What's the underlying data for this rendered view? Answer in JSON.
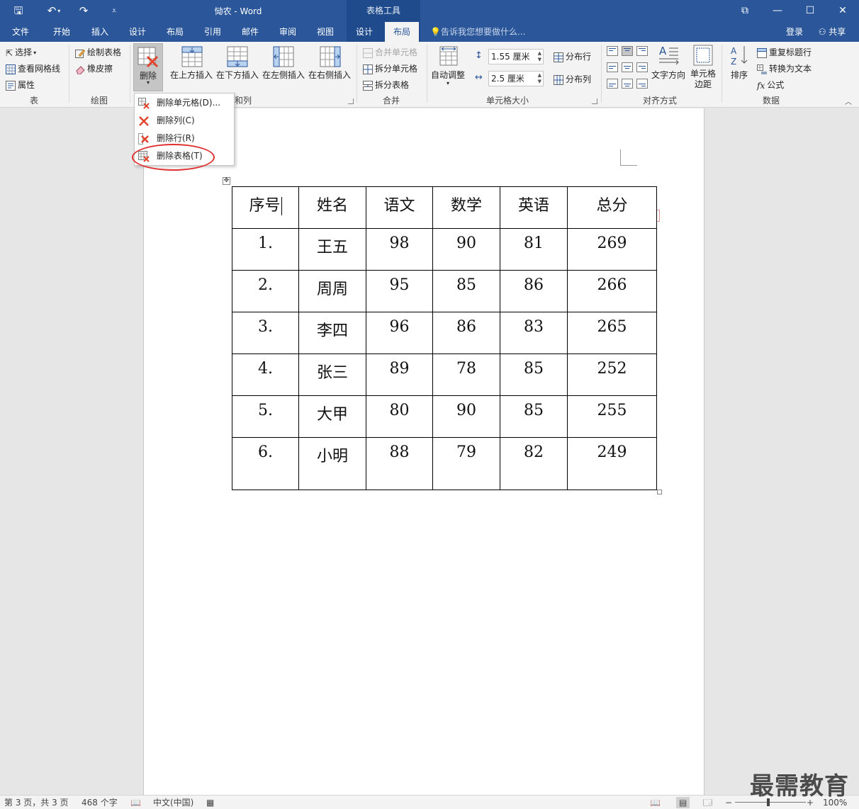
{
  "titlebar": {
    "doc_title": "恸农 - Word",
    "contextual_tools": "表格工具",
    "qat_save": "🖫",
    "qat_undo": "↶",
    "qat_redo": "↷",
    "qat_customize": "⩡",
    "btn_ribbon_display": "⧉",
    "btn_minimize": "—",
    "btn_maximize": "☐",
    "btn_close": "✕"
  },
  "tabs": {
    "file": "文件",
    "home": "开始",
    "insert": "插入",
    "design": "设计",
    "layout_page": "布局",
    "references": "引用",
    "mailings": "邮件",
    "review": "审阅",
    "view": "视图",
    "table_design": "设计",
    "table_layout": "布局",
    "tell_me": "告诉我您想要做什么...",
    "signin": "登录",
    "share": "共享"
  },
  "ribbon": {
    "table_group": {
      "label": "表",
      "select": "选择",
      "view_gridlines": "查看网格线",
      "properties": "属性"
    },
    "draw_group": {
      "label": "绘图",
      "draw_table": "绘制表格",
      "eraser": "橡皮擦"
    },
    "rows_cols_group": {
      "label": "和列",
      "delete": "删除",
      "insert_above": "在上方插入",
      "insert_below": "在下方插入",
      "insert_left": "在左侧插入",
      "insert_right": "在右侧插入"
    },
    "merge_group": {
      "label": "合并",
      "merge_cells": "合并单元格",
      "split_cells": "拆分单元格",
      "split_table": "拆分表格"
    },
    "cell_size_group": {
      "label": "单元格大小",
      "autofit": "自动调整",
      "height_value": "1.55 厘米",
      "width_value": "2.5 厘米",
      "distribute_rows": "分布行",
      "distribute_cols": "分布列"
    },
    "alignment_group": {
      "label": "对齐方式",
      "text_direction": "文字方向",
      "cell_margins_1": "单元格",
      "cell_margins_2": "边距"
    },
    "data_group": {
      "label": "数据",
      "sort": "排序",
      "repeat_header": "重复标题行",
      "convert_to_text": "转换为文本",
      "formula": "公式"
    }
  },
  "delete_menu": {
    "items": [
      {
        "label": "删除单元格(D)..."
      },
      {
        "label": "删除列(C)"
      },
      {
        "label": "删除行(R)"
      },
      {
        "label": "删除表格(T)"
      }
    ]
  },
  "table": {
    "headers": [
      "序号",
      "姓名",
      "语文",
      "数学",
      "英语",
      "总分"
    ],
    "rows": [
      [
        "1.",
        "王五",
        "98",
        "90",
        "81",
        "269"
      ],
      [
        "2.",
        "周周",
        "95",
        "85",
        "86",
        "266"
      ],
      [
        "3.",
        "李四",
        "96",
        "86",
        "83",
        "265"
      ],
      [
        "4.",
        "张三",
        "89",
        "78",
        "85",
        "252"
      ],
      [
        "5.",
        "大甲",
        "80",
        "90",
        "85",
        "255"
      ],
      [
        "6.",
        "小明",
        "88",
        "79",
        "82",
        "249"
      ]
    ]
  },
  "statusbar": {
    "page": "第 3 页，共 3 页",
    "words": "468 个字",
    "language": "中文(中国)",
    "zoom": "100%"
  },
  "watermark": "最需教育",
  "colors": {
    "word_blue": "#2b579a",
    "tools_blue": "#1f4b8c",
    "ribbon_bg": "#f3f3f3",
    "highlight_red": "#e03030"
  }
}
